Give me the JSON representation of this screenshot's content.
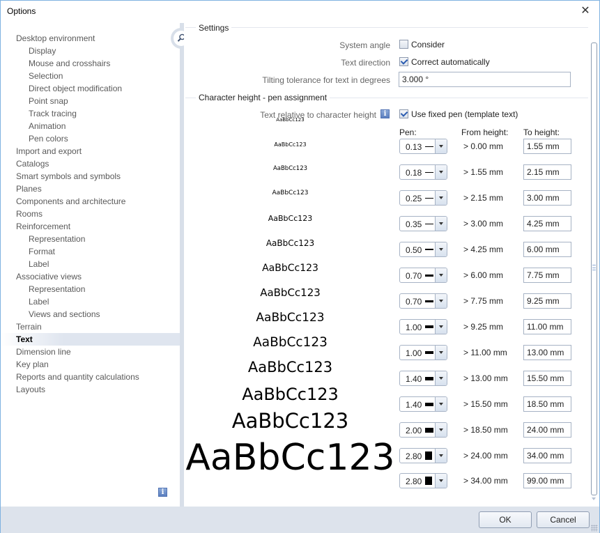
{
  "window": {
    "title": "Options",
    "close_label": "✕"
  },
  "sidebar": {
    "items": [
      {
        "label": "Desktop environment",
        "level": 0
      },
      {
        "label": "Display",
        "level": 1
      },
      {
        "label": "Mouse and crosshairs",
        "level": 1
      },
      {
        "label": "Selection",
        "level": 1
      },
      {
        "label": "Direct object modification",
        "level": 1
      },
      {
        "label": "Point snap",
        "level": 1
      },
      {
        "label": "Track tracing",
        "level": 1
      },
      {
        "label": "Animation",
        "level": 1
      },
      {
        "label": "Pen colors",
        "level": 1
      },
      {
        "label": "Import and export",
        "level": 0
      },
      {
        "label": "Catalogs",
        "level": 0
      },
      {
        "label": "Smart symbols and symbols",
        "level": 0
      },
      {
        "label": "Planes",
        "level": 0
      },
      {
        "label": "Components and architecture",
        "level": 0
      },
      {
        "label": "Rooms",
        "level": 0
      },
      {
        "label": "Reinforcement",
        "level": 0
      },
      {
        "label": "Representation",
        "level": 1
      },
      {
        "label": "Format",
        "level": 1
      },
      {
        "label": "Label",
        "level": 1
      },
      {
        "label": "Associative views",
        "level": 0
      },
      {
        "label": "Representation",
        "level": 1
      },
      {
        "label": "Label",
        "level": 1
      },
      {
        "label": "Views and sections",
        "level": 1
      },
      {
        "label": "Terrain",
        "level": 0
      },
      {
        "label": "Text",
        "level": 0,
        "selected": true
      },
      {
        "label": "Dimension line",
        "level": 0
      },
      {
        "label": "Key plan",
        "level": 0
      },
      {
        "label": "Reports and quantity calculations",
        "level": 0
      },
      {
        "label": "Layouts",
        "level": 0
      }
    ],
    "info_icon": "i"
  },
  "settings": {
    "section_title": "Settings",
    "system_angle": {
      "label": "System angle",
      "checkbox_label": "Consider",
      "checked": false
    },
    "text_direction": {
      "label": "Text direction",
      "checkbox_label": "Correct automatically",
      "checked": true
    },
    "tilting_tolerance": {
      "label": "Tilting tolerance for text in degrees",
      "value": "3.000 °"
    }
  },
  "pen_assignment": {
    "section_title": "Character height - pen assignment",
    "relative_label": "Text relative to character height",
    "info_icon": "i",
    "fixed_pen": {
      "label": "Use fixed pen (template text)",
      "checked": true
    },
    "headers": {
      "pen": "Pen:",
      "from": "From height:",
      "to": "To height:"
    },
    "sample_text": "AaBbCc123",
    "rows": [
      {
        "pen": "0.13",
        "from": "> 0.00 mm",
        "to": "1.55 mm"
      },
      {
        "pen": "0.18",
        "from": "> 1.55 mm",
        "to": "2.15 mm"
      },
      {
        "pen": "0.25",
        "from": "> 2.15 mm",
        "to": "3.00 mm"
      },
      {
        "pen": "0.35",
        "from": "> 3.00 mm",
        "to": "4.25 mm"
      },
      {
        "pen": "0.50",
        "from": "> 4.25 mm",
        "to": "6.00 mm"
      },
      {
        "pen": "0.70",
        "from": "> 6.00 mm",
        "to": "7.75 mm"
      },
      {
        "pen": "0.70",
        "from": "> 7.75 mm",
        "to": "9.25 mm"
      },
      {
        "pen": "1.00",
        "from": "> 9.25 mm",
        "to": "11.00 mm"
      },
      {
        "pen": "1.00",
        "from": "> 11.00 mm",
        "to": "13.00 mm"
      },
      {
        "pen": "1.40",
        "from": "> 13.00 mm",
        "to": "15.50 mm"
      },
      {
        "pen": "1.40",
        "from": "> 15.50 mm",
        "to": "18.50 mm"
      },
      {
        "pen": "2.00",
        "from": "> 18.50 mm",
        "to": "24.00 mm"
      },
      {
        "pen": "2.80",
        "from": "> 24.00 mm",
        "to": "34.00 mm"
      },
      {
        "pen": "2.80",
        "from": "> 34.00 mm",
        "to": "99.00 mm"
      }
    ]
  },
  "footer": {
    "ok_label": "OK",
    "cancel_label": "Cancel"
  }
}
